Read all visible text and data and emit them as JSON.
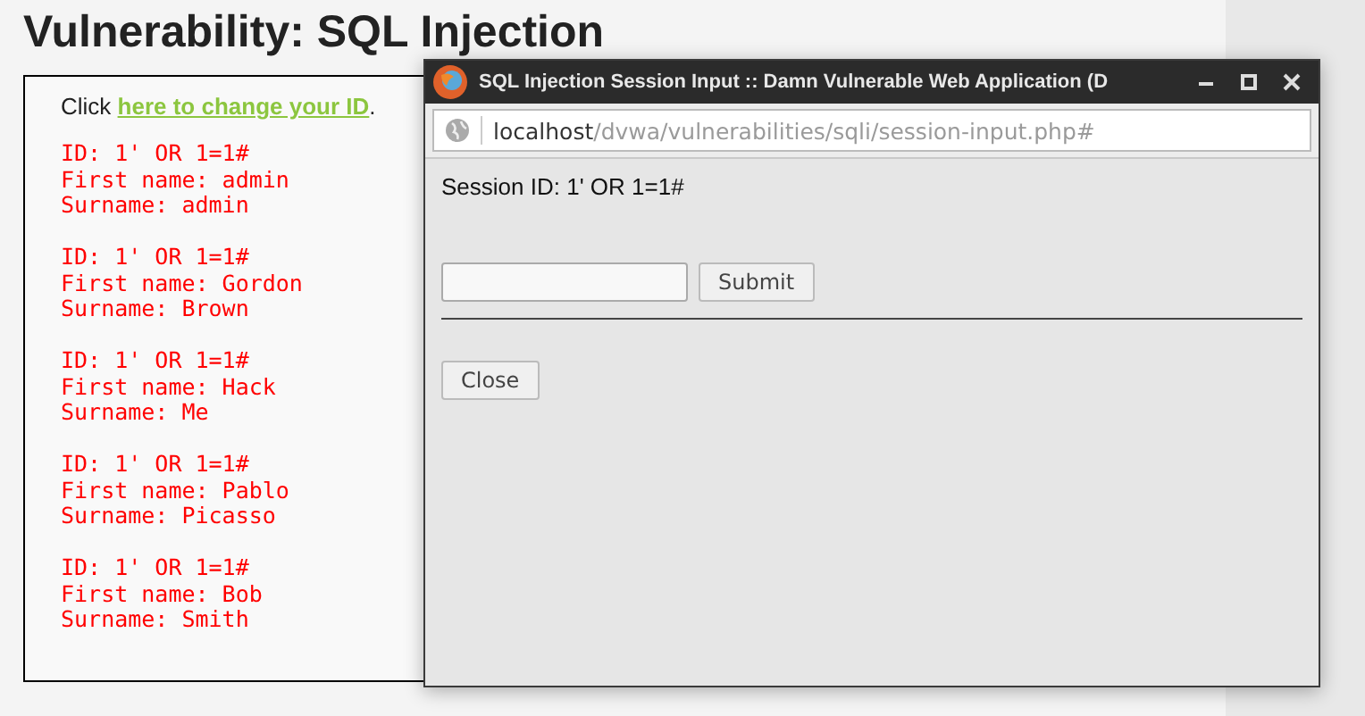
{
  "page": {
    "heading": "Vulnerability: SQL Injection",
    "intro_prefix": "Click ",
    "intro_link": "here to change your ID",
    "intro_suffix": ".",
    "records": [
      {
        "id": "ID: 1' OR 1=1#",
        "first_name": "First name: admin",
        "surname": "Surname: admin"
      },
      {
        "id": "ID: 1' OR 1=1#",
        "first_name": "First name: Gordon",
        "surname": "Surname: Brown"
      },
      {
        "id": "ID: 1' OR 1=1#",
        "first_name": "First name: Hack",
        "surname": "Surname: Me"
      },
      {
        "id": "ID: 1' OR 1=1#",
        "first_name": "First name: Pablo",
        "surname": "Surname: Picasso"
      },
      {
        "id": "ID: 1' OR 1=1#",
        "first_name": "First name: Bob",
        "surname": "Surname: Smith"
      }
    ]
  },
  "popup": {
    "title": "SQL Injection Session Input :: Damn Vulnerable Web Application (D",
    "url_host": "localhost",
    "url_path": "/dvwa/vulnerabilities/sqli/session-input.php#",
    "session_text": "Session ID: 1' OR 1=1#",
    "submit": "Submit",
    "close": "Close"
  }
}
